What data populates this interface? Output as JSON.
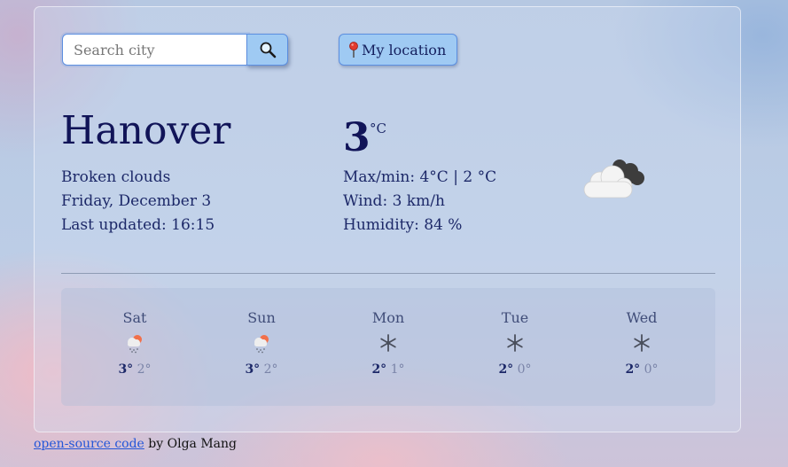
{
  "search": {
    "placeholder": "Search city",
    "button_icon": "magnifier-icon"
  },
  "location_button": {
    "icon": "pin-icon",
    "label": "My location"
  },
  "current": {
    "city": "Hanover",
    "description": "Broken clouds",
    "date": "Friday, December 3",
    "last_updated": "Last updated: 16:15",
    "temperature": "3",
    "unit": "°C",
    "max_min": "Max/min: 4°C | 2 °C",
    "wind": "Wind: 3 km/h",
    "humidity": "Humidity: 84 %",
    "icon": "broken-clouds-icon"
  },
  "forecast": [
    {
      "day": "Sat",
      "max": "3°",
      "min": "2°",
      "icon": "snow-cloud-sun-icon"
    },
    {
      "day": "Sun",
      "max": "3°",
      "min": "2°",
      "icon": "snow-cloud-sun-icon"
    },
    {
      "day": "Mon",
      "max": "2°",
      "min": "1°",
      "icon": "snowflake-icon"
    },
    {
      "day": "Tue",
      "max": "2°",
      "min": "0°",
      "icon": "snowflake-icon"
    },
    {
      "day": "Wed",
      "max": "2°",
      "min": "0°",
      "icon": "snowflake-icon"
    }
  ],
  "footer": {
    "link_text": "open-source code",
    "suffix": " by Olga Mang"
  },
  "colors": {
    "accent_button": "#9fcaf3",
    "heading": "#111458",
    "link": "#2456d8"
  }
}
